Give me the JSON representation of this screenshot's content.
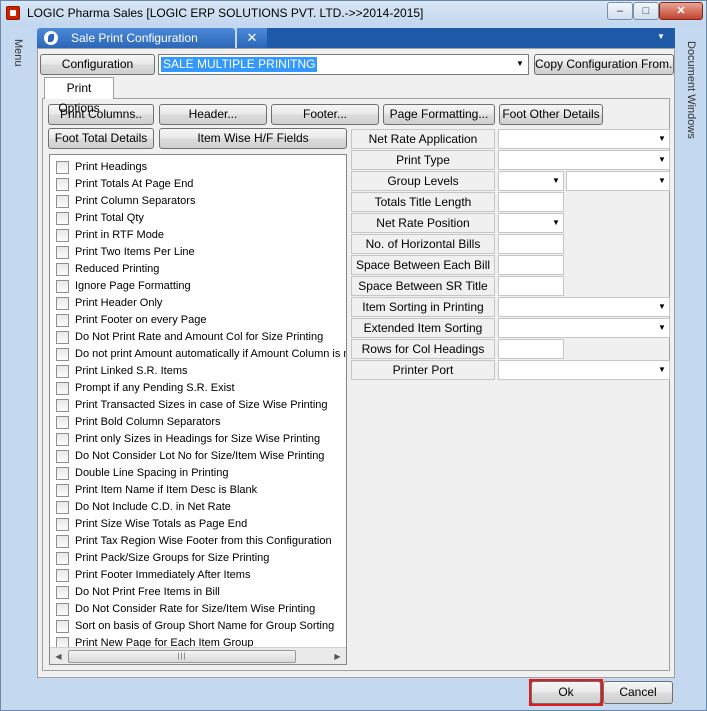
{
  "window": {
    "title": "LOGIC Pharma Sales  [LOGIC ERP SOLUTIONS PVT. LTD.->>2014-2015]",
    "minimize_glyph": "–",
    "maximize_glyph": "□",
    "close_glyph": "✕"
  },
  "side_panels": {
    "left": "Menu",
    "right": "Document Windows"
  },
  "doc_tab": {
    "label": "Sale Print Configuration",
    "close_glyph": "✕"
  },
  "config": {
    "label": "Configuration",
    "selected_value": "SALE MULTIPLE PRINITNG",
    "copy_label": "Copy  Configuration From.."
  },
  "print_options_tab": "Print Options",
  "buttons_row1": [
    "Print Columns..",
    "Header...",
    "Footer...",
    "Page Formatting...",
    "Foot Other Details"
  ],
  "buttons_row2": [
    "Foot Total Details",
    "Item Wise H/F Fields"
  ],
  "checkboxes": [
    {
      "label": "Print Headings",
      "checked": false
    },
    {
      "label": "Print Totals At Page End",
      "checked": false
    },
    {
      "label": "Print Column Separators",
      "checked": false
    },
    {
      "label": "Print Total Qty",
      "checked": false
    },
    {
      "label": "Print in RTF Mode",
      "checked": false
    },
    {
      "label": "Print Two Items Per Line",
      "checked": false
    },
    {
      "label": "Reduced Printing",
      "checked": false
    },
    {
      "label": "Ignore Page Formatting",
      "checked": false
    },
    {
      "label": "Print Header Only",
      "checked": false
    },
    {
      "label": "Print Footer on every Page",
      "checked": false
    },
    {
      "label": "Do Not Print Rate and Amount Col for Size Printing",
      "checked": false
    },
    {
      "label": "Do not print Amount automatically if Amount Column is not",
      "checked": false
    },
    {
      "label": "Print Linked S.R. Items",
      "checked": false
    },
    {
      "label": "Prompt if any Pending S.R. Exist",
      "checked": false
    },
    {
      "label": "Print Transacted Sizes in case of Size Wise Printing",
      "checked": false
    },
    {
      "label": "Print Bold Column Separators",
      "checked": false
    },
    {
      "label": "Print only Sizes in Headings for Size Wise Printing",
      "checked": false
    },
    {
      "label": "Do Not Consider Lot No for Size/Item Wise Printing",
      "checked": false
    },
    {
      "label": "Double Line Spacing in Printing",
      "checked": false
    },
    {
      "label": "Print Item Name if Item Desc is Blank",
      "checked": false
    },
    {
      "label": "Do Not Include C.D. in Net Rate",
      "checked": false
    },
    {
      "label": "Print Size Wise Totals as Page End",
      "checked": false
    },
    {
      "label": "Print Tax Region Wise Footer from this Configuration",
      "checked": false
    },
    {
      "label": "Print Pack/Size Groups for Size Printing",
      "checked": false
    },
    {
      "label": "Print Footer Immediately After Items",
      "checked": false
    },
    {
      "label": "Do Not Print Free Items in Bill",
      "checked": false
    },
    {
      "label": "Do Not Consider Rate for Size/Item Wise Printing",
      "checked": false
    },
    {
      "label": "Sort on basis of Group Short Name for Group Sorting",
      "checked": false
    },
    {
      "label": "Print New Page for Each Item Group",
      "checked": false
    }
  ],
  "scrollbar": {
    "left_glyph": "◀",
    "right_glyph": "▶",
    "thumb_grip": "|||"
  },
  "fields": [
    {
      "label": "Net Rate Application",
      "value": "",
      "dropdown": true
    },
    {
      "label": "Print Type",
      "value": "",
      "dropdown": true
    },
    {
      "label": "Group Levels",
      "value": "",
      "dropdown": true
    },
    {
      "label": "Totals Title Length",
      "value": "",
      "dropdown": false
    },
    {
      "label": "Net Rate Position",
      "value": "",
      "dropdown": true
    },
    {
      "label": "No. of Horizontal Bills",
      "value": "",
      "dropdown": false
    },
    {
      "label": "Space Between Each Bill",
      "value": "",
      "dropdown": false
    },
    {
      "label": "Space Between SR Title",
      "value": "",
      "dropdown": false
    },
    {
      "label": "Item Sorting in Printing",
      "value": "",
      "dropdown": true
    },
    {
      "label": "Extended Item Sorting",
      "value": "",
      "dropdown": true
    },
    {
      "label": "Rows for Col Headings",
      "value": "",
      "dropdown": false
    },
    {
      "label": "Printer Port",
      "value": "",
      "dropdown": true
    }
  ],
  "dropdown_glyph": "▼",
  "footer": {
    "ok_label": "Ok",
    "cancel_label": "Cancel"
  }
}
